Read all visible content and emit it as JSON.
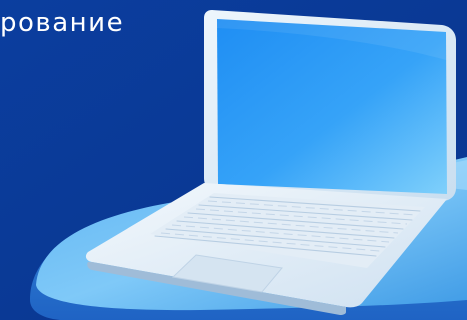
{
  "banner": {
    "headline": "рование",
    "illustration_icon": "laptop-icon",
    "colors": {
      "background": "#0a3c9a",
      "headline_text": "#ffffff",
      "screen": "#2a9af5",
      "platform": "#7cc6f8"
    }
  }
}
